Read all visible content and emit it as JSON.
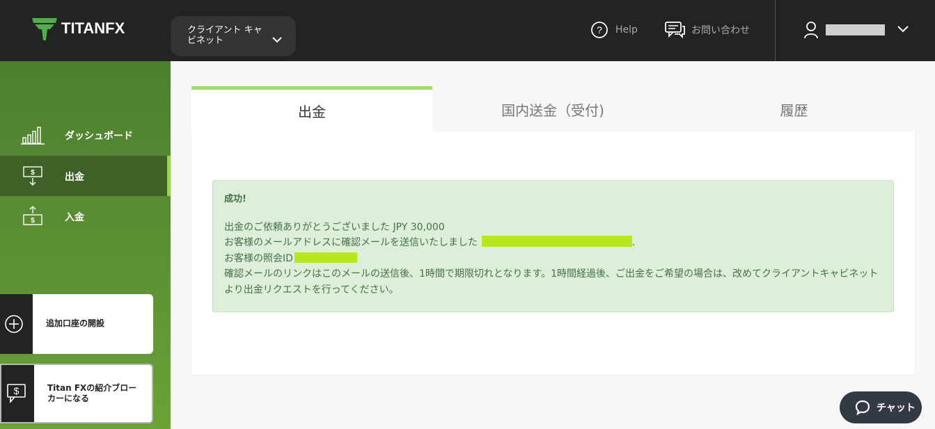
{
  "header": {
    "brand": "TITANFX",
    "cabinet_label": "クライアント キャビネット",
    "help_label": "Help",
    "contact_label": "お問い合わせ"
  },
  "sidebar": {
    "items": [
      {
        "label": "ダッシュボード",
        "icon": "bar-chart-icon"
      },
      {
        "label": "出金",
        "icon": "withdraw-icon"
      },
      {
        "label": "入金",
        "icon": "deposit-icon"
      }
    ],
    "cards": [
      {
        "label": "追加口座の開設",
        "icon": "plus-circle-icon"
      },
      {
        "label": "Titan FXの紹介ブローカーになる",
        "icon": "dollar-chat-icon"
      }
    ]
  },
  "tabs": [
    {
      "label": "出金",
      "active": true
    },
    {
      "label": "国内送金（受付)",
      "active": false
    },
    {
      "label": "履歴",
      "active": false
    }
  ],
  "alert": {
    "title": "成功!",
    "line1": "出金のご依頼ありがとうございました JPY 30,000",
    "line2": "お客様のメールアドレスに確認メールを送信いたしました",
    "line3": "お客様の照会ID",
    "line4": "確認メールのリンクはこのメールの送信後、1時間で期限切れとなります。1時間経過後、ご出金をご希望の場合は、改めてクライアントキャビネットより出金リクエストを行ってください。"
  },
  "chat": {
    "label": "チャット"
  },
  "colors": {
    "accent": "#9ee062",
    "sidebar": "#5e9234",
    "header": "#232323",
    "highlight": "#b6e81d"
  }
}
